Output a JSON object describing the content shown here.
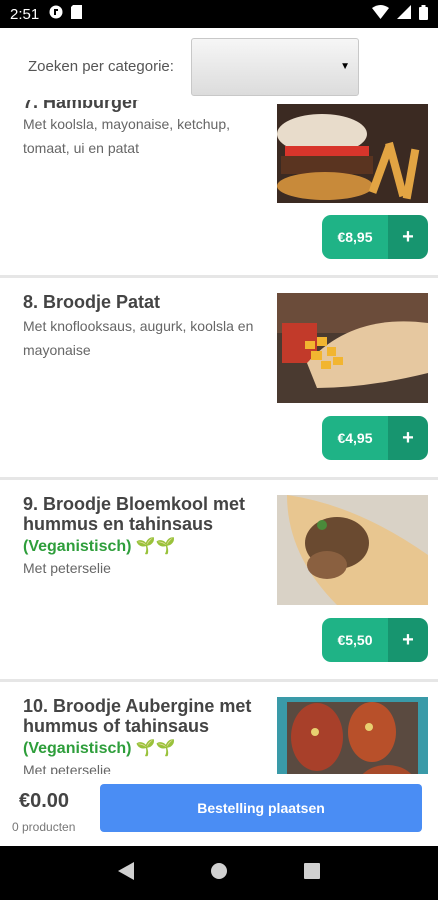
{
  "status_bar": {
    "time": "2:51",
    "icons": [
      "app-notification-icon",
      "sim-icon",
      "wifi-icon",
      "signal-icon",
      "battery-icon"
    ]
  },
  "filter": {
    "label": "Zoeken per categorie:",
    "selected": ""
  },
  "items": [
    {
      "title": "7. Hamburger",
      "desc": "Met koolsla, mayonaise, ketchup, tomaat, ui en patat",
      "price": "€8,95",
      "add": "+"
    },
    {
      "title": "8. Broodje Patat",
      "desc": "Met knoflooksaus, augurk, koolsla en mayonaise",
      "price": "€4,95",
      "add": "+"
    },
    {
      "title": "9. Broodje Bloemkool met hummus en tahinsaus",
      "veg": "(Veganistisch) 🌱🌱",
      "desc": "Met peterselie",
      "price": "€5,50",
      "add": "+"
    },
    {
      "title": "10. Broodje Aubergine met hummus of tahinsaus",
      "veg": "(Veganistisch) 🌱🌱",
      "desc": "Met peterselie"
    }
  ],
  "footer": {
    "total": "€0.00",
    "count": "0 producten",
    "order_button": "Bestelling plaatsen"
  },
  "nav": {
    "icons": [
      "back-icon",
      "home-icon",
      "recents-icon"
    ]
  },
  "colors": {
    "price_button": "#1fb386",
    "plus_button": "#17956f",
    "order_button": "#4a8df4",
    "vegan_text": "#2e9e3b"
  }
}
